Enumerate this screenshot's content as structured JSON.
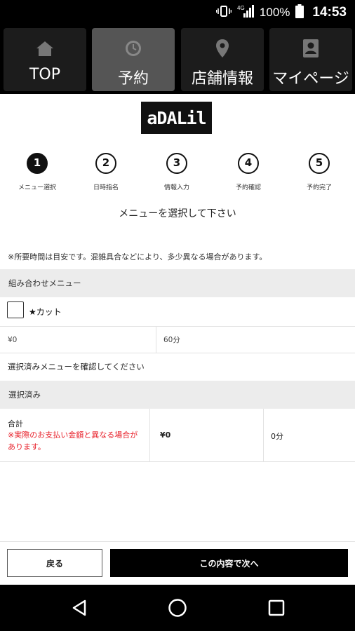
{
  "status_bar": {
    "battery": "100%",
    "time": "14:53",
    "icons": [
      "vibrate-icon",
      "signal-4g-icon",
      "battery-icon"
    ]
  },
  "nav": {
    "tabs": [
      {
        "label": "TOP",
        "icon": "home-icon",
        "active": false
      },
      {
        "label": "予約",
        "icon": "clock-icon",
        "active": true
      },
      {
        "label": "店舗情報",
        "icon": "map-pin-icon",
        "active": false
      },
      {
        "label": "マイページ",
        "icon": "profile-icon",
        "active": false
      }
    ]
  },
  "logo": {
    "text": "aDALil"
  },
  "steps": [
    {
      "num": "1",
      "label": "メニュー選択",
      "active": true
    },
    {
      "num": "2",
      "label": "日時指名",
      "active": false
    },
    {
      "num": "3",
      "label": "情報入力",
      "active": false
    },
    {
      "num": "4",
      "label": "予約確認",
      "active": false
    },
    {
      "num": "5",
      "label": "予約完了",
      "active": false
    }
  ],
  "heading": "メニューを選択して下さい",
  "note": "※所要時間は目安です。混雑具合などにより、多少異なる場合があります。",
  "combo_section": {
    "title": "組み合わせメニュー",
    "item": {
      "name": "★カット",
      "price": "¥0",
      "duration": "60分",
      "checked": false
    }
  },
  "confirm_text": "選択済みメニューを確認してください",
  "selected_section": {
    "title": "選択済み",
    "total_label": "合計",
    "warning": "※実際のお支払い金額と異なる場合があります。",
    "total_price": "¥0",
    "total_duration": "0分"
  },
  "buttons": {
    "back": "戻る",
    "next": "この内容で次へ"
  },
  "colors": {
    "accent": "#000000",
    "warning": "#e8202a",
    "section_bg": "#ececec",
    "active_tab": "#555555"
  }
}
